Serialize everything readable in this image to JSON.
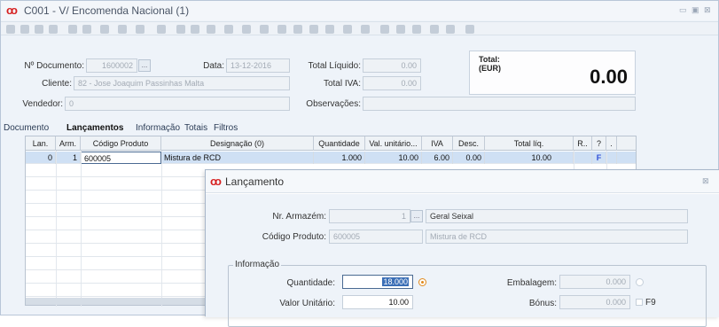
{
  "window": {
    "title": "C001 - V/ Encomenda Nacional (1)",
    "controls": [
      "▭",
      "▣",
      "⊠"
    ]
  },
  "header": {
    "doc_label": "Nº Documento:",
    "doc_value": "1600002",
    "doc_button": "...",
    "data_label": "Data:",
    "data_value": "13-12-2016",
    "cliente_label": "Cliente:",
    "cliente_value": "82 - Jose Joaquim Passinhas Malta",
    "vendedor_label": "Vendedor:",
    "vendedor_value": "0",
    "liquido_label": "Total Líquido:",
    "liquido_value": "0.00",
    "iva_label": "Total IVA:",
    "iva_value": "0.00",
    "obs_label": "Observações:",
    "obs_value": "",
    "total_label_1": "Total:",
    "total_label_2": "(EUR)",
    "total_value": "0.00"
  },
  "tabs": [
    "Documento",
    "Lançamentos",
    "Informação",
    "Totais",
    "Filtros"
  ],
  "grid": {
    "headers": [
      "Lan.",
      "Arm.",
      "Código Produto",
      "Designação (0)",
      "Quantidade",
      "Val. unitário...",
      "IVA",
      "Desc.",
      "Total líq.",
      "R..",
      "?",
      "."
    ],
    "rows": [
      {
        "lan": "0",
        "arm": "1",
        "codigo": "600005",
        "designacao": "Mistura de RCD",
        "quantidade": "1.000",
        "val_unit": "10.00",
        "iva": "6.00",
        "desc": "0.00",
        "total": "10.00",
        "r": "",
        "q": "F",
        "dot": ""
      }
    ]
  },
  "dialog": {
    "title": "Lançamento",
    "close": "⊠",
    "armazem_label": "Nr. Armazém:",
    "armazem_value": "1",
    "armazem_button": "...",
    "armazem_name": "Geral Seixal",
    "produto_label": "Código Produto:",
    "produto_value": "600005",
    "produto_name": "Mistura de RCD",
    "group_title": "Informação",
    "quantidade_label": "Quantidade:",
    "quantidade_value": "18.000",
    "valor_label": "Valor Unitário:",
    "valor_value": "10.00",
    "embalagem_label": "Embalagem:",
    "embalagem_value": "0.000",
    "bonus_label": "Bónus:",
    "bonus_value": "0.000",
    "f9_label": "F9"
  },
  "colors": {
    "logo": "#d62020",
    "accent": "#e08a1e",
    "selected_row": "#cfe0f4",
    "flag": "#2f4fd8"
  }
}
